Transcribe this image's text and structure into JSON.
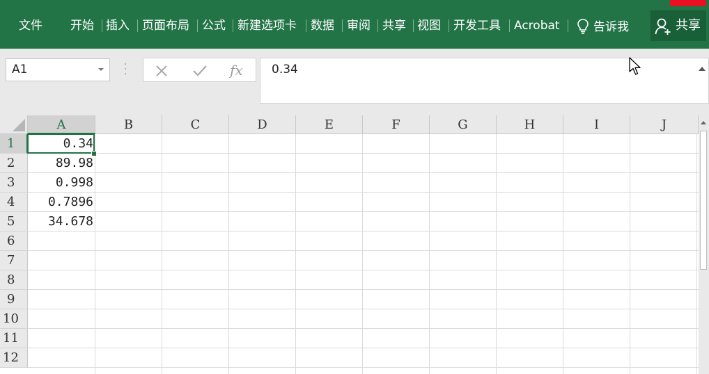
{
  "ribbon": {
    "tabs": [
      "文件",
      "开始",
      "插入",
      "页面布局",
      "公式",
      "新建选项卡",
      "数据",
      "审阅",
      "共享",
      "视图",
      "开发工具",
      "Acrobat"
    ],
    "tell_me": "告诉我",
    "share": "共享",
    "colors": {
      "ribbon_bg": "#227447",
      "share_bg": "#195f38",
      "accent_red": "#e81123"
    }
  },
  "formula_bar": {
    "name_box": "A1",
    "formula": "0.34",
    "fx_label": "fx"
  },
  "grid": {
    "columns": [
      "A",
      "B",
      "C",
      "D",
      "E",
      "F",
      "G",
      "H",
      "I",
      "J"
    ],
    "rows": [
      "1",
      "2",
      "3",
      "4",
      "5",
      "6",
      "7",
      "8",
      "9",
      "10",
      "11",
      "12"
    ],
    "active_cell": "A1",
    "column_a_values": [
      "0.34",
      "89.98",
      "0.998",
      "0.7896",
      "34.678"
    ],
    "accent": "#217346"
  }
}
